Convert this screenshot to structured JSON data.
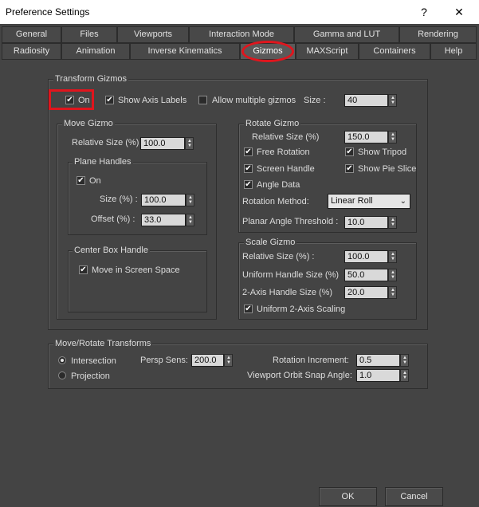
{
  "window": {
    "title": "Preference Settings",
    "help_glyph": "?",
    "close_glyph": "✕"
  },
  "tabs": {
    "row1": [
      "General",
      "Files",
      "Viewports",
      "Interaction Mode",
      "Gamma and LUT",
      "Rendering"
    ],
    "row2": [
      "Radiosity",
      "Animation",
      "Inverse Kinematics",
      "Gizmos",
      "MAXScript",
      "Containers",
      "Help"
    ],
    "active": "Gizmos"
  },
  "transform_gizmos": {
    "legend": "Transform Gizmos",
    "on": {
      "label": "On",
      "checked": true
    },
    "show_axis_labels": {
      "label": "Show Axis Labels",
      "checked": true
    },
    "allow_multiple_gizmos": {
      "label": "Allow multiple gizmos",
      "checked": false
    },
    "size_label": "Size :",
    "size_value": "40"
  },
  "move_gizmo": {
    "legend": "Move Gizmo",
    "relative_size_label": "Relative Size (%)",
    "relative_size_value": "100.0",
    "plane_handles": {
      "legend": "Plane Handles",
      "on": {
        "label": "On",
        "checked": true
      },
      "size_label": "Size (%) :",
      "size_value": "100.0",
      "offset_label": "Offset (%) :",
      "offset_value": "33.0"
    },
    "center_box_handle": {
      "legend": "Center Box Handle",
      "move_in_screen_space": {
        "label": "Move in Screen Space",
        "checked": true
      }
    }
  },
  "rotate_gizmo": {
    "legend": "Rotate Gizmo",
    "relative_size_label": "Relative Size (%)",
    "relative_size_value": "150.0",
    "free_rotation": {
      "label": "Free Rotation",
      "checked": true
    },
    "show_tripod": {
      "label": "Show Tripod",
      "checked": true
    },
    "screen_handle": {
      "label": "Screen Handle",
      "checked": true
    },
    "show_pie_slice": {
      "label": "Show Pie Slice",
      "checked": true
    },
    "angle_data": {
      "label": "Angle Data",
      "checked": true
    },
    "rotation_method_label": "Rotation Method:",
    "rotation_method_value": "Linear Roll",
    "planar_angle_threshold_label": "Planar Angle Threshold :",
    "planar_angle_threshold_value": "10.0"
  },
  "scale_gizmo": {
    "legend": "Scale Gizmo",
    "relative_size_label": "Relative Size (%) :",
    "relative_size_value": "100.0",
    "uniform_handle_size_label": "Uniform Handle Size (%)",
    "uniform_handle_size_value": "50.0",
    "two_axis_handle_size_label": "2-Axis Handle Size (%)",
    "two_axis_handle_size_value": "20.0",
    "uniform_2_axis_scaling": {
      "label": "Uniform 2-Axis Scaling",
      "checked": true
    }
  },
  "move_rotate_transforms": {
    "legend": "Move/Rotate Transforms",
    "intersection": {
      "label": "Intersection",
      "selected": true
    },
    "projection": {
      "label": "Projection",
      "selected": false
    },
    "persp_sens_label": "Persp Sens:",
    "persp_sens_value": "200.0",
    "rotation_increment_label": "Rotation Increment:",
    "rotation_increment_value": "0.5",
    "viewport_orbit_snap_angle_label": "Viewport Orbit Snap Angle:",
    "viewport_orbit_snap_angle_value": "1.0"
  },
  "footer": {
    "ok_label": "OK",
    "cancel_label": "Cancel"
  },
  "glyphs": {
    "check": "✔",
    "spin_up": "▲",
    "spin_down": "▼",
    "chevron_down": "⌄"
  },
  "colors": {
    "annotation_red": "#e0151d",
    "background": "#444444"
  }
}
